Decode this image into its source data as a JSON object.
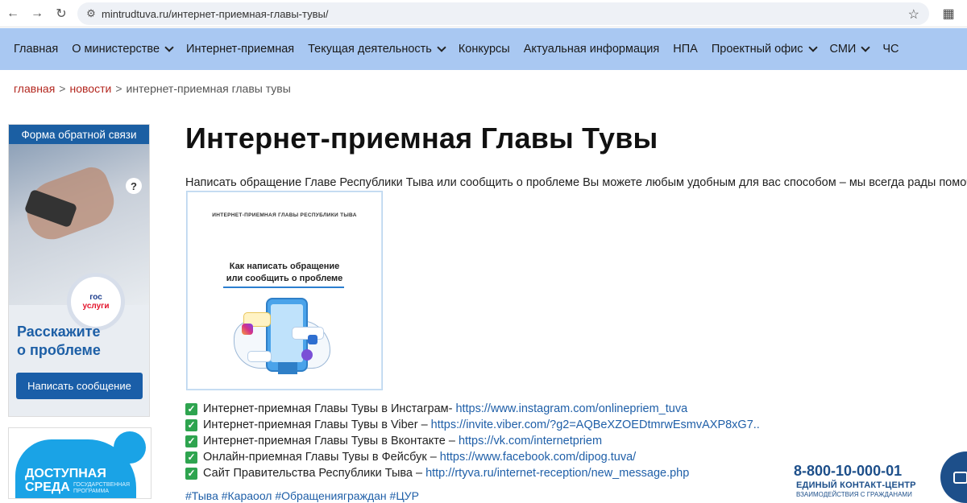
{
  "browser": {
    "url": "mintrudtuva.ru/интернет-приемная-главы-тувы/"
  },
  "menu": {
    "items": [
      {
        "label": "Главная",
        "dropdown": false
      },
      {
        "label": "О министерстве",
        "dropdown": true
      },
      {
        "label": "Интернет-приемная",
        "dropdown": false
      },
      {
        "label": "Текущая деятельность",
        "dropdown": true
      },
      {
        "label": "Конкурсы",
        "dropdown": false
      },
      {
        "label": "Актуальная информация",
        "dropdown": false
      },
      {
        "label": "НПА",
        "dropdown": false
      },
      {
        "label": "Проектный офис",
        "dropdown": true
      },
      {
        "label": "СМИ",
        "dropdown": true
      },
      {
        "label": "ЧС",
        "dropdown": false
      }
    ]
  },
  "breadcrumb": {
    "home": "главная",
    "news": "новости",
    "current": "интернет-приемная главы тувы",
    "separator": ">"
  },
  "sidebar": {
    "feedback_banner": {
      "header": "Форма обратной связи",
      "logo_line1": "гос",
      "logo_line2": "услуги",
      "tagline_line1": "Расскажите",
      "tagline_line2": "о проблеме",
      "button": "Написать сообщение"
    },
    "access_banner": {
      "title_line1": "ДОСТУПНАЯ",
      "title_line2": "СРЕДА",
      "sub_line1": "ГОСУДАРСТВЕННАЯ",
      "sub_line2": "ПРОГРАММА"
    }
  },
  "main": {
    "title": "Интернет-приемная Главы Тувы",
    "intro": "Написать обращение Главе Республики Тыва или сообщить о проблеме Вы можете любым удобным для вас способом – мы всегда рады помочь!",
    "infographic": {
      "top": "ИНТЕРНЕТ-ПРИЕМНАЯ ГЛАВЫ РЕСПУБЛИКИ ТЫВА",
      "heading_line1": "Как написать обращение",
      "heading_line2": "или сообщить о проблеме"
    },
    "links": [
      {
        "text": "Интернет-приемная Главы Тувы в Инстаграм-",
        "url": "https://www.instagram.com/onlinepriem_tuva"
      },
      {
        "text": "Интернет-приемная Главы Тувы в Viber –",
        "url": "https://invite.viber.com/?g2=AQBeXZOEDtmrwEsmvAXP8xG7.."
      },
      {
        "text": "Интернет-приемная Главы Тувы в Вконтакте –",
        "url": "https://vk.com/internetpriem"
      },
      {
        "text": "Онлайн-приемная Главы Тувы в Фейсбук –",
        "url": "https://www.facebook.com/dipog.tuva/"
      },
      {
        "text": "Сайт Правительства Республики Тыва –",
        "url": "http://rtyva.ru/internet-reception/new_message.php"
      }
    ],
    "tags": "#Тыва #Караоол #Обращенияграждан #ЦУР"
  },
  "contact_center": {
    "phone": "8-800-10-000-01",
    "label": "ЕДИНЫЙ КОНТАКТ-ЦЕНТР",
    "sub": "ВЗАИМОДЕЙСТВИЯ С ГРАЖДАНАМИ"
  },
  "colors": {
    "menu_bg": "#a9c8f2",
    "link": "#1f5fa8",
    "breadcrumb_link": "#b3261e",
    "brand_blue": "#1a5ea8"
  }
}
